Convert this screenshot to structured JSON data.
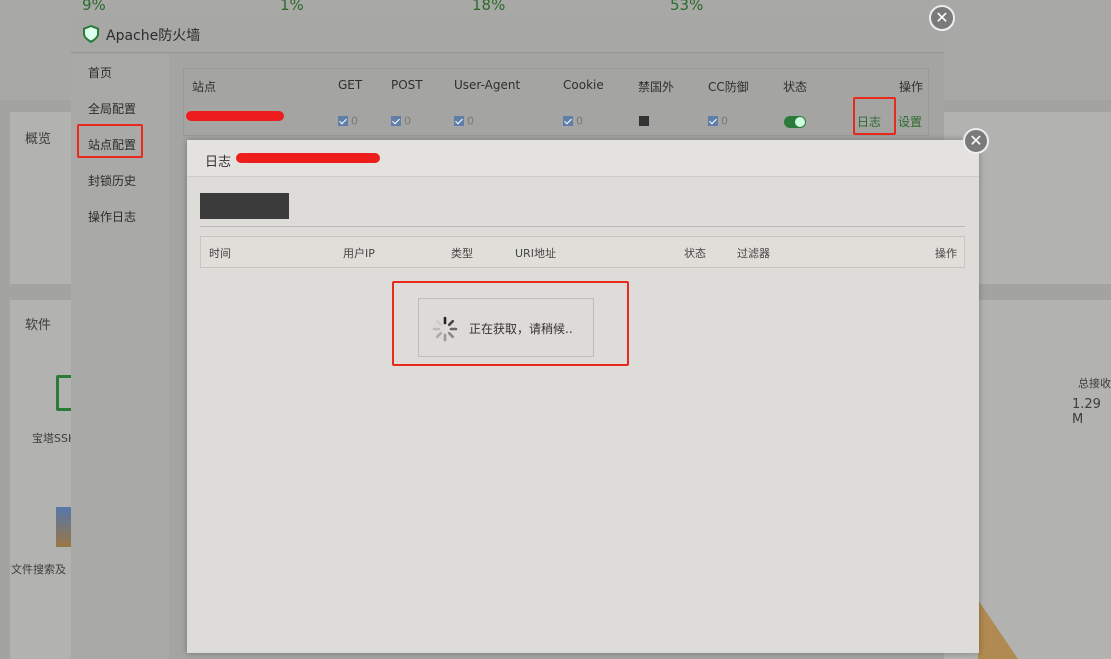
{
  "background": {
    "percents": [
      "9%",
      "1%",
      "18%",
      "53%"
    ],
    "overview_title": "概览",
    "software_title": "软件",
    "ssh_label": "宝塔SSH",
    "file_search_label": "文件搜索及",
    "total_recv_label": "总接收",
    "total_recv_value": "1.29 M"
  },
  "firewall": {
    "title": "Apache防火墙",
    "sidebar": [
      {
        "label": "首页"
      },
      {
        "label": "全局配置"
      },
      {
        "label": "站点配置"
      },
      {
        "label": "封锁历史"
      },
      {
        "label": "操作日志"
      }
    ],
    "table": {
      "headers": [
        "站点",
        "GET",
        "POST",
        "User-Agent",
        "Cookie",
        "禁国外",
        "CC防御",
        "状态",
        "操作"
      ],
      "row": {
        "get": "0",
        "post": "0",
        "user_agent": "0",
        "cookie": "0",
        "cc": "0"
      },
      "log_link": "日志",
      "settings_link": "设置"
    }
  },
  "log_dialog": {
    "title": "日志",
    "headers": [
      "时间",
      "用户IP",
      "类型",
      "URI地址",
      "状态",
      "过滤器",
      "操作"
    ],
    "loading_text": "正在获取，请稍候.."
  },
  "colors": {
    "accent_green": "#2a7a3a",
    "highlight_red": "#e8291c"
  },
  "icons": {
    "close": "close-icon",
    "shield": "shield-icon",
    "spinner": "spinner-icon"
  }
}
